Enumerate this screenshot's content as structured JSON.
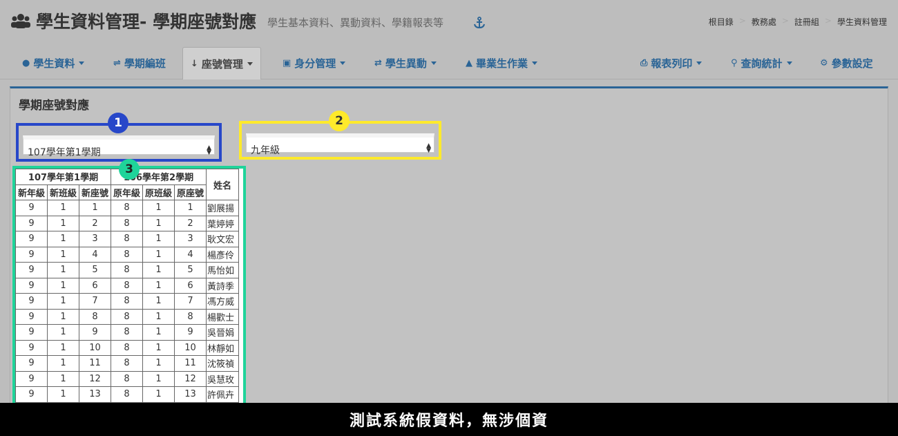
{
  "header": {
    "title": "學生資料管理- 學期座號對應",
    "subtitle": "學生基本資料、異動資料、學籍報表等",
    "breadcrumb": [
      "根目錄",
      "教務處",
      "註冊組",
      "學生資料管理"
    ]
  },
  "nav": {
    "items": [
      {
        "label": "學生資料",
        "icon": "users-icon",
        "dropdown": true
      },
      {
        "label": "學期編班",
        "icon": "shuffle-icon",
        "dropdown": false
      },
      {
        "label": "座號管理",
        "icon": "sort-icon",
        "dropdown": true,
        "active": true
      },
      {
        "label": "身分管理",
        "icon": "id-card-icon",
        "dropdown": true
      },
      {
        "label": "學生異動",
        "icon": "exchange-icon",
        "dropdown": true
      },
      {
        "label": "畢業生作業",
        "icon": "graduation-cap-icon",
        "dropdown": true
      },
      {
        "label": "報表列印",
        "icon": "printer-icon",
        "dropdown": true
      },
      {
        "label": "查詢統計",
        "icon": "search-icon",
        "dropdown": true
      },
      {
        "label": "參數設定",
        "icon": "gear-icon",
        "dropdown": false
      }
    ]
  },
  "panel": {
    "title": "學期座號對應",
    "semester_select": "107學年第1學期",
    "grade_select": "九年級"
  },
  "badges": [
    "1",
    "2",
    "3"
  ],
  "table": {
    "group_headers": [
      "107學年第1學期",
      "106學年第2學期",
      "姓名"
    ],
    "columns": [
      "新年級",
      "新班級",
      "新座號",
      "原年級",
      "原班級",
      "原座號"
    ],
    "rows": [
      [
        "9",
        "1",
        "1",
        "8",
        "1",
        "1",
        "劉展揚"
      ],
      [
        "9",
        "1",
        "2",
        "8",
        "1",
        "2",
        "葉婷婷"
      ],
      [
        "9",
        "1",
        "3",
        "8",
        "1",
        "3",
        "耿文宏"
      ],
      [
        "9",
        "1",
        "4",
        "8",
        "1",
        "4",
        "楊彥伶"
      ],
      [
        "9",
        "1",
        "5",
        "8",
        "1",
        "5",
        "馬怡如"
      ],
      [
        "9",
        "1",
        "6",
        "8",
        "1",
        "6",
        "黃詩季"
      ],
      [
        "9",
        "1",
        "7",
        "8",
        "1",
        "7",
        "馮方威"
      ],
      [
        "9",
        "1",
        "8",
        "8",
        "1",
        "8",
        "楊歡士"
      ],
      [
        "9",
        "1",
        "9",
        "8",
        "1",
        "9",
        "吳晉娟"
      ],
      [
        "9",
        "1",
        "10",
        "8",
        "1",
        "10",
        "林靜如"
      ],
      [
        "9",
        "1",
        "11",
        "8",
        "1",
        "11",
        "沈筱禎"
      ],
      [
        "9",
        "1",
        "12",
        "8",
        "1",
        "12",
        "吳慧玫"
      ],
      [
        "9",
        "1",
        "13",
        "8",
        "1",
        "13",
        "許佩卉"
      ]
    ]
  },
  "footer": {
    "caption": "測試系統假資料，無涉個資"
  },
  "colors": {
    "accent": "#2a6496",
    "badge1": "#2747c9",
    "badge2": "#ffea2b",
    "badge3": "#1fd49a"
  }
}
